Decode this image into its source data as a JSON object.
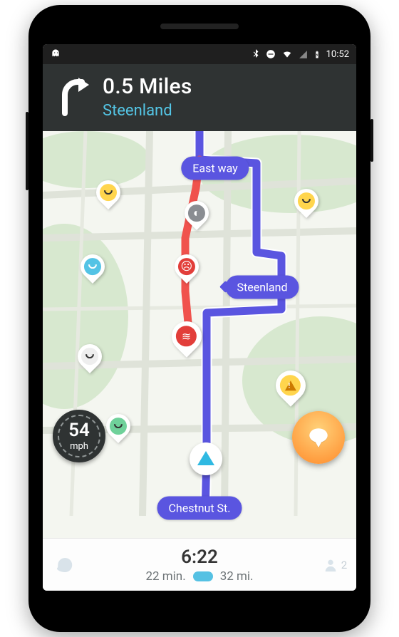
{
  "status": {
    "time": "10:52"
  },
  "directions": {
    "distance": "0.5 Miles",
    "street": "Steenland"
  },
  "labels": {
    "east_way": "East way",
    "steenland": "Steenland",
    "chestnut": "Chestnut St."
  },
  "speed": {
    "value": "54",
    "unit": "mph"
  },
  "bottom": {
    "eta": "6:22",
    "duration": "22 min.",
    "distance": "32 mi.",
    "friends_count": "2"
  }
}
